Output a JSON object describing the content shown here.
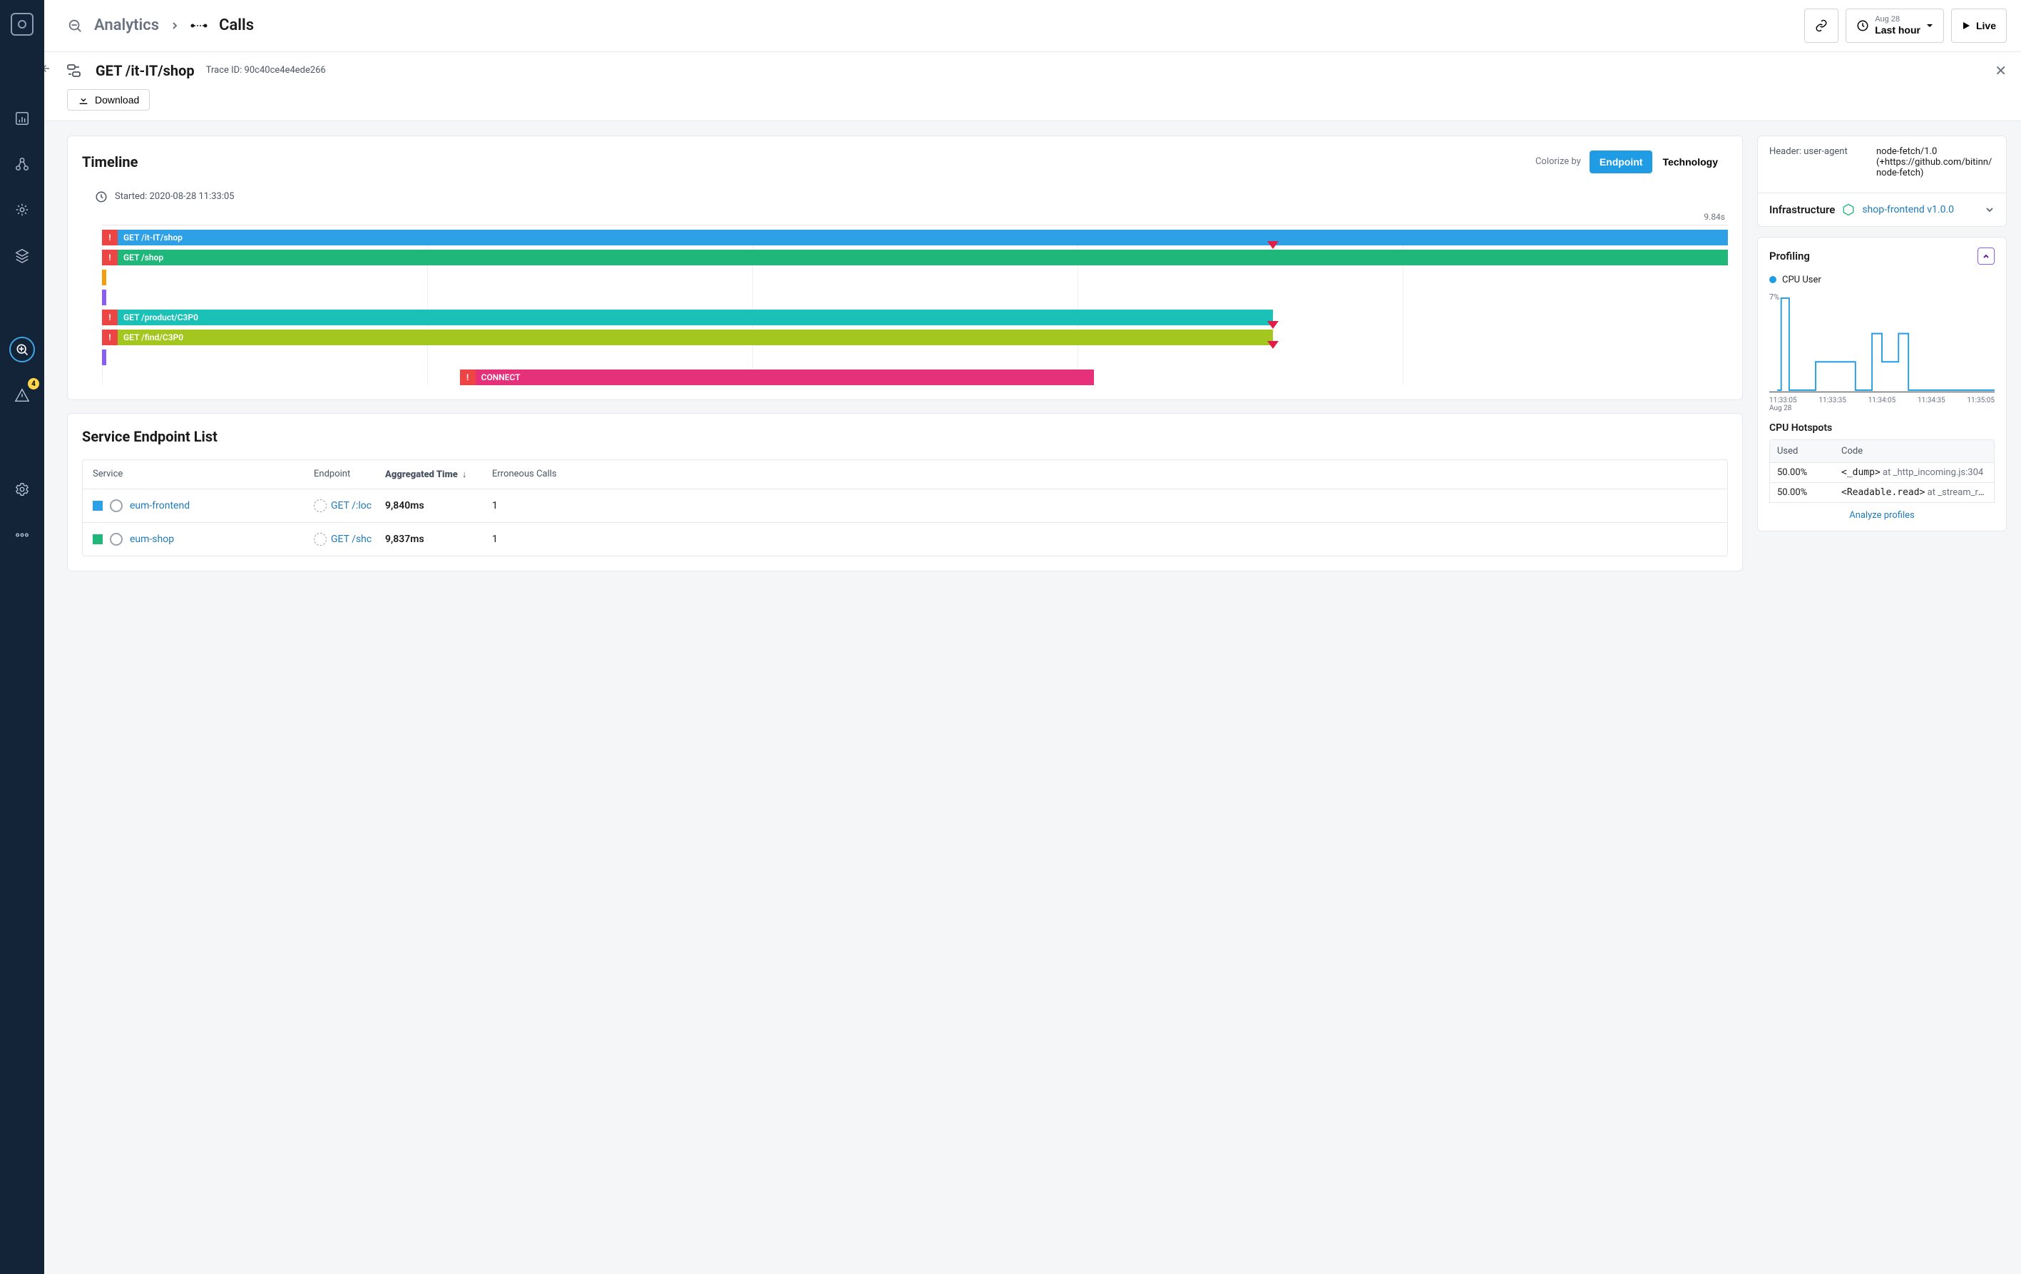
{
  "breadcrumb": {
    "analytics": "Analytics",
    "calls": "Calls"
  },
  "topbar": {
    "time_date": "Aug 28",
    "time_range": "Last hour",
    "live": "Live"
  },
  "sidebar": {
    "alert_badge": "4"
  },
  "trace": {
    "title": "GET /it-IT/shop",
    "id_label": "Trace ID: 90c40ce4e4ede266",
    "download": "Download"
  },
  "timeline": {
    "title": "Timeline",
    "colorize_label": "Colorize by",
    "tab_endpoint": "Endpoint",
    "tab_technology": "Technology",
    "started_label": "Started: 2020-08-28 11:33:05",
    "total_time": "9.84s",
    "bars": [
      {
        "label": "GET /it-IT/shop",
        "color": "#2ea0e6",
        "left": 0,
        "width": 100,
        "error": true
      },
      {
        "label": "GET /shop",
        "color": "#1fb87a",
        "left": 0,
        "width": 100,
        "error": true
      },
      {
        "label": "",
        "color": "#f59e0b",
        "left": 0,
        "width": 1.2,
        "error": false,
        "stub": true
      },
      {
        "label": "",
        "color": "#8b5cf6",
        "left": 0,
        "width": 1.2,
        "error": false,
        "stub": true
      },
      {
        "label": "GET /product/C3P0",
        "color": "#19c1b6",
        "left": 0,
        "width": 72,
        "error": true
      },
      {
        "label": "GET /find/C3P0",
        "color": "#a3c71f",
        "left": 0,
        "width": 72,
        "error": true
      },
      {
        "label": "",
        "color": "#8b5cf6",
        "left": 0,
        "width": 1.2,
        "error": false,
        "stub": true
      },
      {
        "label": "CONNECT",
        "color": "#e6317a",
        "left": 22,
        "width": 50,
        "error": true,
        "indent": true
      }
    ],
    "markers": [
      {
        "row": 0,
        "pos": 72
      },
      {
        "row": 4,
        "pos": 72
      },
      {
        "row": 5,
        "pos": 72
      }
    ]
  },
  "sel": {
    "title": "Service Endpoint List",
    "cols": {
      "service": "Service",
      "endpoint": "Endpoint",
      "agg": "Aggregated Time",
      "err": "Erroneous Calls"
    },
    "rows": [
      {
        "color": "#2ea0e6",
        "service": "eum-frontend",
        "endpoint": "GET /:loc",
        "agg": "9,840ms",
        "err": "1"
      },
      {
        "color": "#1fb87a",
        "service": "eum-shop",
        "endpoint": "GET /shc",
        "agg": "9,837ms",
        "err": "1"
      }
    ]
  },
  "details": {
    "header_ua_key": "Header: user-agent",
    "header_ua_val": "node-fetch/1.0 (+https://github.com/bitinn/node-fetch)"
  },
  "infra": {
    "title": "Infrastructure",
    "link": "shop-frontend v1.0.0"
  },
  "profiling": {
    "title": "Profiling",
    "legend": "CPU User",
    "ylabel": "7%",
    "xticks": [
      "11:33:05",
      "11:33:35",
      "11:34:05",
      "11:34:35",
      "11:35:05"
    ],
    "xdate": "Aug 28",
    "hotspots_title": "CPU Hotspots",
    "hot_cols": {
      "used": "Used",
      "code": "Code"
    },
    "hot_rows": [
      {
        "used": "50.00%",
        "code": "<_dump>",
        "loc": "at _http_incoming.js:304"
      },
      {
        "used": "50.00%",
        "code": "<Readable.read>",
        "loc": "at _stream_rea..."
      }
    ],
    "analyze": "Analyze profiles"
  },
  "chart_data": {
    "type": "line",
    "title": "CPU User",
    "ylabel": "%",
    "ylim": [
      0,
      7
    ],
    "x": [
      "11:33:05",
      "11:33:20",
      "11:33:35",
      "11:33:50",
      "11:34:05",
      "11:34:20",
      "11:34:35",
      "11:35:05"
    ],
    "values": [
      7,
      0,
      2,
      2,
      0,
      4,
      0,
      0
    ]
  }
}
